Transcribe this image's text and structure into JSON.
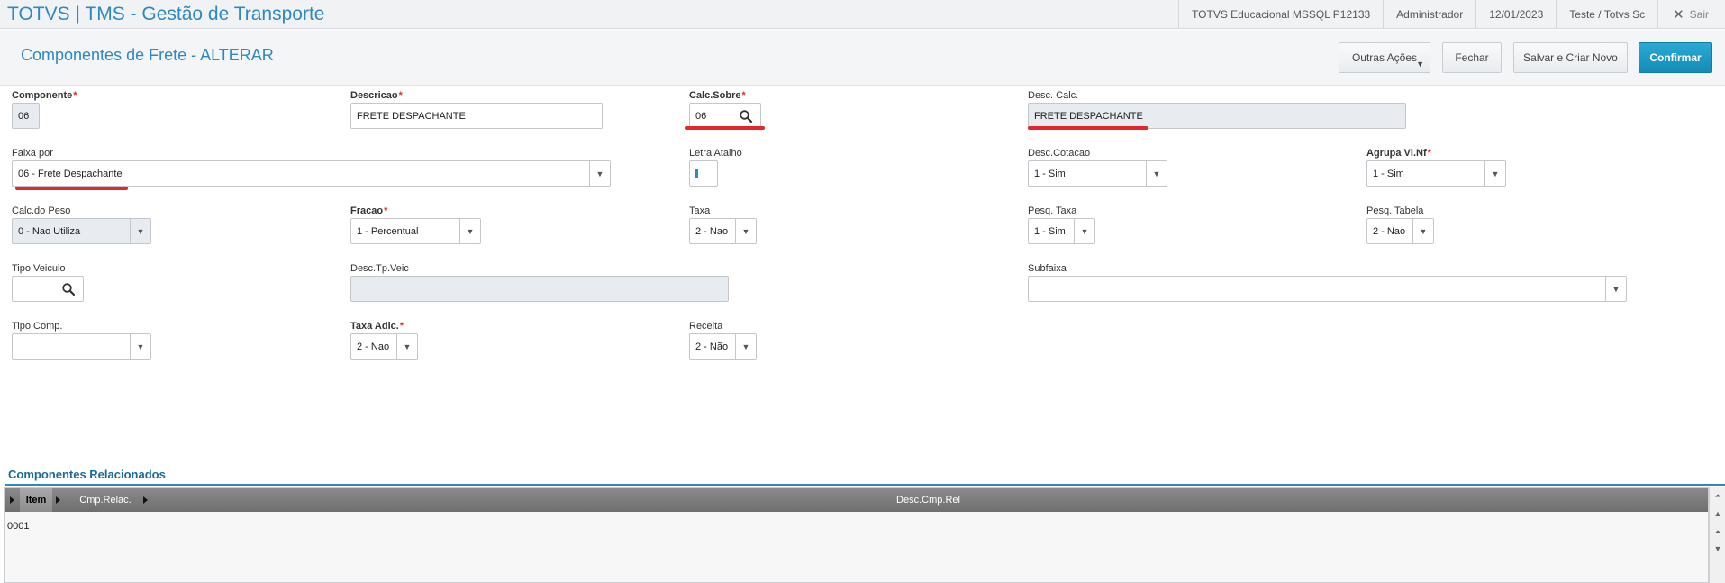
{
  "app": {
    "title": "TOTVS | TMS - Gestão de Transporte",
    "environment": "TOTVS Educacional MSSQL P12133",
    "user": "Administrador",
    "date": "12/01/2023",
    "company": "Teste / Totvs Sc",
    "logout_label": "Sair"
  },
  "header": {
    "title": "Componentes de Frete - ALTERAR",
    "buttons": {
      "outras": "Outras Ações",
      "fechar": "Fechar",
      "salvar": "Salvar e Criar Novo",
      "confirmar": "Confirmar"
    }
  },
  "form": {
    "componente": {
      "label": "Componente",
      "value": "06"
    },
    "descricao": {
      "label": "Descricao",
      "value": "FRETE DESPACHANTE"
    },
    "calc_sobre": {
      "label": "Calc.Sobre",
      "value": "06"
    },
    "desc_calc": {
      "label": "Desc. Calc.",
      "value": "FRETE DESPACHANTE"
    },
    "faixa_por": {
      "label": "Faixa por",
      "value": "06 - Frete Despachante"
    },
    "letra_atalho": {
      "label": "Letra Atalho",
      "value": ""
    },
    "desc_cotacao": {
      "label": "Desc.Cotacao",
      "value": "1 - Sim"
    },
    "agrupa_vl_nf": {
      "label": "Agrupa Vl.Nf",
      "value": "1 - Sim"
    },
    "calc_peso": {
      "label": "Calc.do Peso",
      "value": "0 - Nao Utiliza"
    },
    "fracao": {
      "label": "Fracao",
      "value": "1 - Percentual"
    },
    "taxa": {
      "label": "Taxa",
      "value": "2 - Nao"
    },
    "pesq_taxa": {
      "label": "Pesq. Taxa",
      "value": "1 - Sim"
    },
    "pesq_tabela": {
      "label": "Pesq. Tabela",
      "value": "2 - Nao"
    },
    "tipo_veiculo": {
      "label": "Tipo Veiculo",
      "value": ""
    },
    "desc_tp_veic": {
      "label": "Desc.Tp.Veic",
      "value": ""
    },
    "subfaixa": {
      "label": "Subfaixa",
      "value": ""
    },
    "tipo_comp": {
      "label": "Tipo Comp.",
      "value": ""
    },
    "taxa_adic": {
      "label": "Taxa Adic.",
      "value": "2 - Nao"
    },
    "receita": {
      "label": "Receita",
      "value": "2 - Não"
    },
    "required_mark": "*"
  },
  "grid": {
    "title": "Componentes Relacionados",
    "columns": [
      "Item",
      "Cmp.Relac.",
      "Desc.Cmp.Rel"
    ],
    "rows": [
      [
        "0001",
        "",
        ""
      ]
    ]
  },
  "colors": {
    "accent": "#2e88c1",
    "confirm": "#138cb8",
    "required": "#e03030",
    "highlight_underline": "#e2262a"
  }
}
